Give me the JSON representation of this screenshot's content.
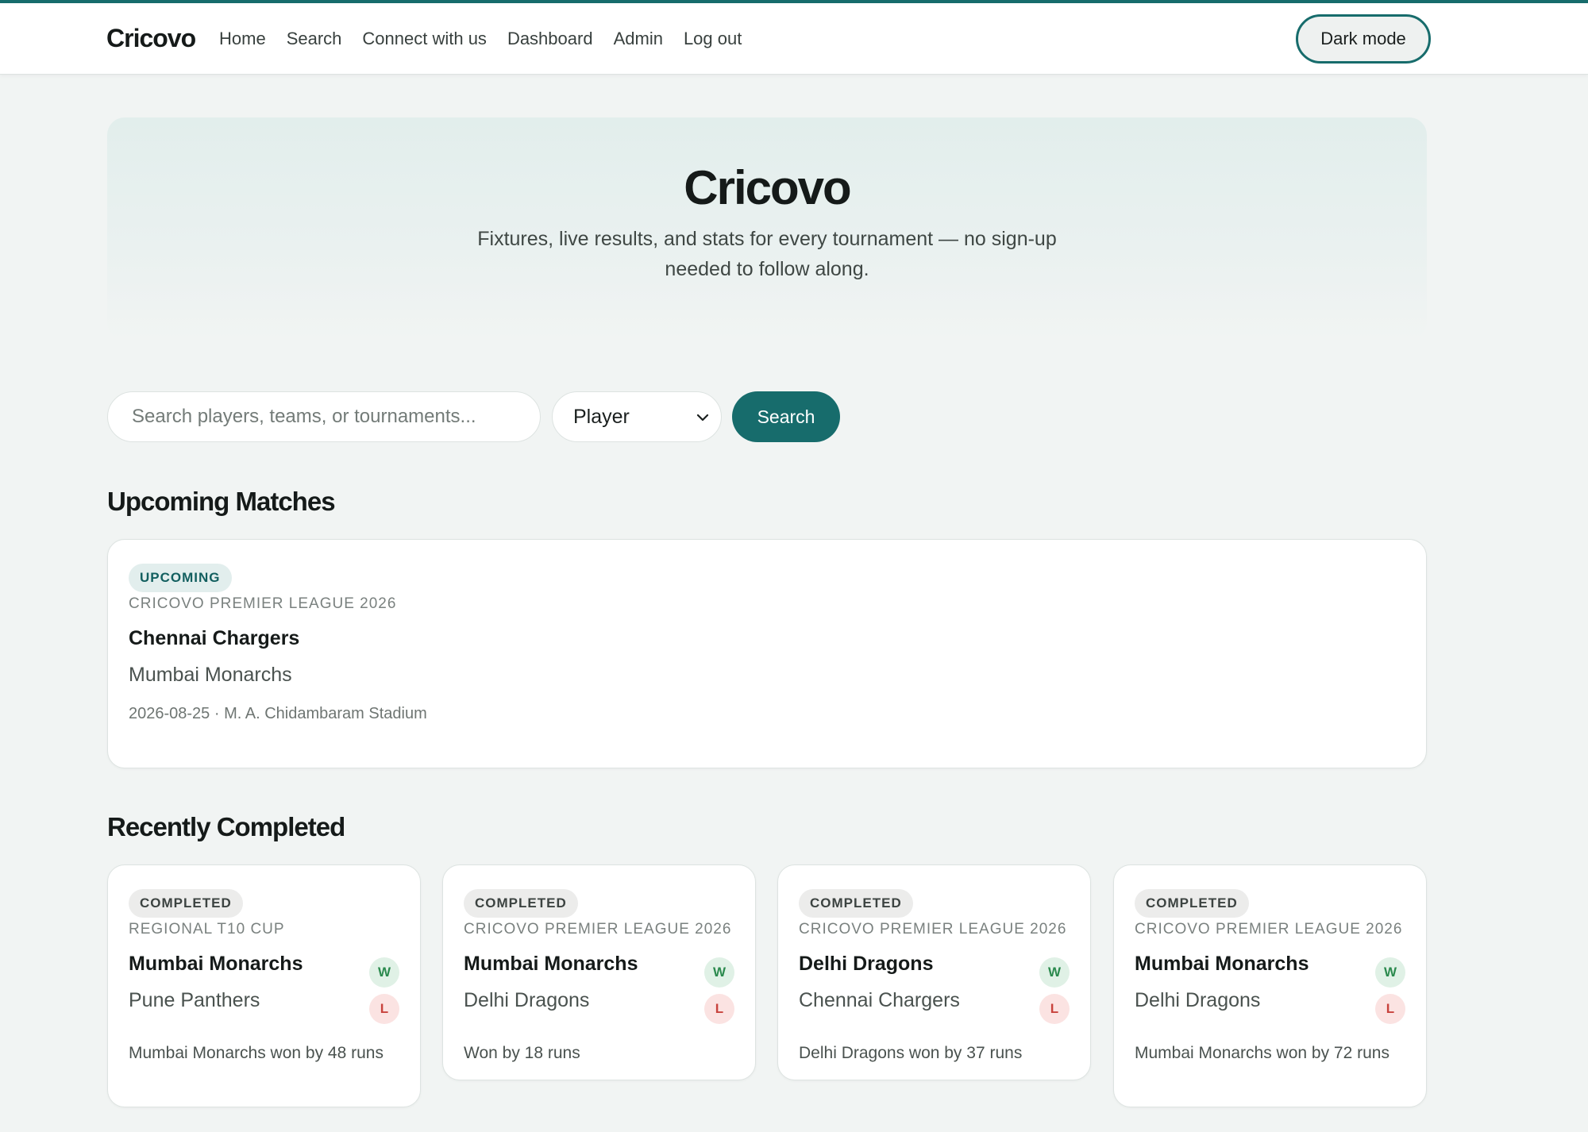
{
  "nav": {
    "brand": "Cricovo",
    "links": [
      "Home",
      "Search",
      "Connect with us",
      "Dashboard",
      "Admin",
      "Log out"
    ],
    "dark_mode_label": "Dark mode"
  },
  "hero": {
    "title": "Cricovo",
    "subtitle": "Fixtures, live results, and stats for every tournament — no sign-up needed to follow along."
  },
  "search": {
    "placeholder": "Search players, teams, or tournaments...",
    "type_selected": "Player",
    "button_label": "Search"
  },
  "upcoming": {
    "title": "Upcoming Matches",
    "matches": [
      {
        "status": "UPCOMING",
        "tournament": "CRICOVO PREMIER LEAGUE 2026",
        "team_a": "Chennai Chargers",
        "team_b": "Mumbai Monarchs",
        "meta": "2026-08-25 · M. A. Chidambaram Stadium"
      }
    ]
  },
  "completed": {
    "title": "Recently Completed",
    "matches": [
      {
        "status": "COMPLETED",
        "tournament": "REGIONAL T10 CUP",
        "winner": "Mumbai Monarchs",
        "loser": "Pune Panthers",
        "win_mark": "W",
        "loss_mark": "L",
        "result": "Mumbai Monarchs won by 48 runs"
      },
      {
        "status": "COMPLETED",
        "tournament": "CRICOVO PREMIER LEAGUE 2026",
        "winner": "Mumbai Monarchs",
        "loser": "Delhi Dragons",
        "win_mark": "W",
        "loss_mark": "L",
        "result": "Won by 18 runs"
      },
      {
        "status": "COMPLETED",
        "tournament": "CRICOVO PREMIER LEAGUE 2026",
        "winner": "Delhi Dragons",
        "loser": "Chennai Chargers",
        "win_mark": "W",
        "loss_mark": "L",
        "result": "Delhi Dragons won by 37 runs"
      },
      {
        "status": "COMPLETED",
        "tournament": "CRICOVO PREMIER LEAGUE 2026",
        "winner": "Mumbai Monarchs",
        "loser": "Delhi Dragons",
        "win_mark": "W",
        "loss_mark": "L",
        "result": "Mumbai Monarchs won by 72 runs"
      }
    ]
  },
  "colors": {
    "accent": "#176c6c",
    "page_background": "#f1f4f3",
    "win": "#2b8a4e",
    "loss": "#c8433d"
  }
}
